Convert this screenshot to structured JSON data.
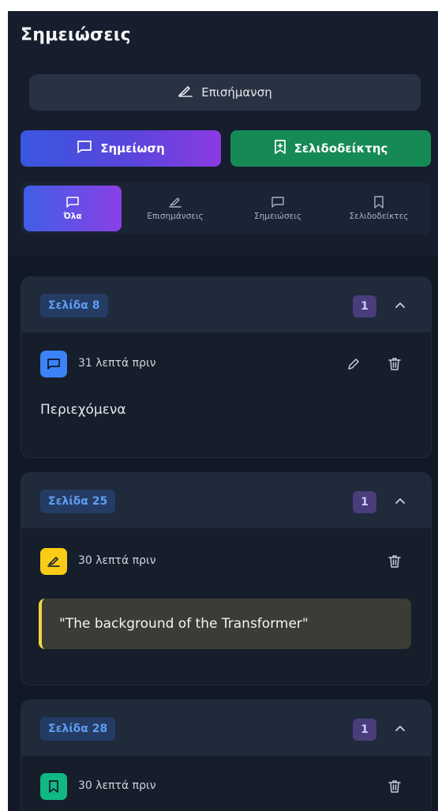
{
  "header": {
    "title": "Σημειώσεις",
    "highlight_button": "Επισήμανση",
    "note_button": "Σημείωση",
    "bookmark_button": "Σελιδοδείκτης"
  },
  "filters": [
    {
      "label": "Όλα",
      "icon": "note-icon",
      "active": true
    },
    {
      "label": "Επισημάνσεις",
      "icon": "highlighter-icon",
      "active": false
    },
    {
      "label": "Σημειώσεις",
      "icon": "note-icon",
      "active": false
    },
    {
      "label": "Σελιδοδείκτες",
      "icon": "bookmark-icon",
      "active": false
    }
  ],
  "groups": [
    {
      "page_label": "Σελίδα 8",
      "count": "1",
      "entry": {
        "type": "note",
        "icon": "note-icon",
        "color": "#3b82f6",
        "time": "31 λεπτά πριν",
        "text": "Περιεχόμενα"
      }
    },
    {
      "page_label": "Σελίδα 25",
      "count": "1",
      "entry": {
        "type": "highlight",
        "icon": "highlighter-icon",
        "color": "#facc15",
        "time": "30 λεπτά πριν",
        "quote": "\"The background of the Transformer\""
      }
    },
    {
      "page_label": "Σελίδα 28",
      "count": "1",
      "entry": {
        "type": "bookmark",
        "icon": "bookmark-icon",
        "color": "#10b981",
        "time": "30 λεπτά πριν"
      }
    }
  ],
  "colors": {
    "panel_bg": "#151c2b",
    "accent_blue": "#3957e0",
    "accent_purple": "#8a3be3",
    "bookmark_green": "#168a55",
    "highlight_yellow": "#f5d53e"
  }
}
